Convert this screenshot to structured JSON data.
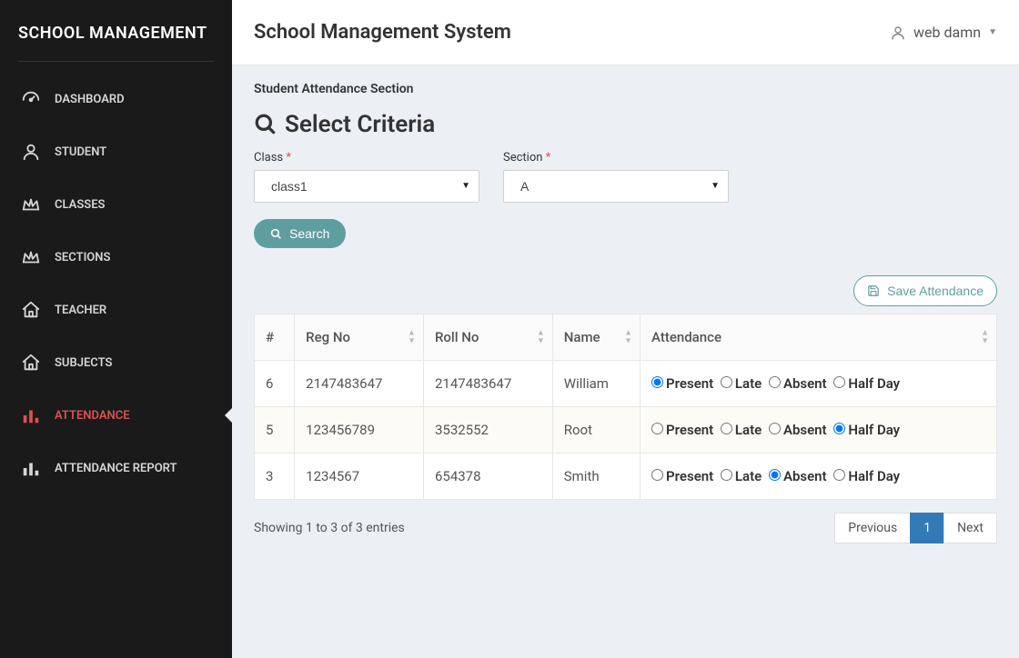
{
  "brand": "SCHOOL MANAGEMENT",
  "header": {
    "title": "School Management System",
    "user": "web damn"
  },
  "sidebar": {
    "items": [
      {
        "label": "DASHBOARD",
        "icon": "dashboard",
        "active": false
      },
      {
        "label": "STUDENT",
        "icon": "user",
        "active": false
      },
      {
        "label": "CLASSES",
        "icon": "crown",
        "active": false
      },
      {
        "label": "SECTIONS",
        "icon": "crown",
        "active": false
      },
      {
        "label": "TEACHER",
        "icon": "home",
        "active": false
      },
      {
        "label": "SUBJECTS",
        "icon": "home",
        "active": false
      },
      {
        "label": "ATTENDANCE",
        "icon": "chart",
        "active": true
      },
      {
        "label": "ATTENDANCE REPORT",
        "icon": "chart",
        "active": false
      }
    ]
  },
  "section_header": "Student Attendance Section",
  "criteria_title": "Select Criteria",
  "filters": {
    "class_label": "Class",
    "section_label": "Section",
    "class_value": "class1",
    "section_value": "A",
    "search_label": "Search"
  },
  "save_btn": "Save Attendance",
  "table": {
    "columns": [
      "#",
      "Reg No",
      "Roll No",
      "Name",
      "Attendance"
    ],
    "options": [
      "Present",
      "Late",
      "Absent",
      "Half Day"
    ],
    "rows": [
      {
        "idx": "6",
        "reg": "2147483647",
        "roll": "2147483647",
        "name": "William",
        "selected": "Present"
      },
      {
        "idx": "5",
        "reg": "123456789",
        "roll": "3532552",
        "name": "Root",
        "selected": "Half Day"
      },
      {
        "idx": "3",
        "reg": "1234567",
        "roll": "654378",
        "name": "Smith",
        "selected": "Absent"
      }
    ]
  },
  "footer": {
    "info": "Showing 1 to 3 of 3 entries",
    "prev": "Previous",
    "page": "1",
    "next": "Next"
  }
}
